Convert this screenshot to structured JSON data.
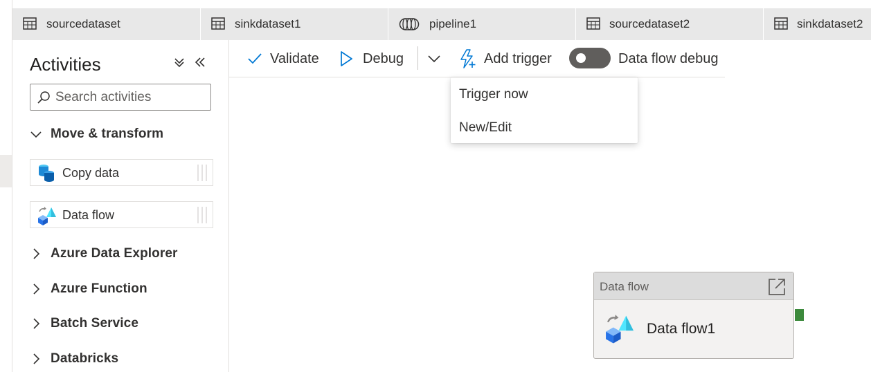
{
  "tabs": [
    {
      "label": "sourcedataset",
      "icon": "table-icon"
    },
    {
      "label": "sinkdataset1",
      "icon": "table-icon"
    },
    {
      "label": "pipeline1",
      "icon": "pipeline-icon"
    },
    {
      "label": "sourcedataset2",
      "icon": "table-icon"
    },
    {
      "label": "sinkdataset2",
      "icon": "table-icon"
    }
  ],
  "sidebar": {
    "title": "Activities",
    "search_placeholder": "Search activities",
    "groups": {
      "move_transform": "Move & transform",
      "azure_data_explorer": "Azure Data Explorer",
      "azure_function": "Azure Function",
      "batch_service": "Batch Service",
      "databricks": "Databricks"
    },
    "activities": {
      "copy_data": "Copy data",
      "data_flow": "Data flow"
    }
  },
  "toolbar": {
    "validate": "Validate",
    "debug": "Debug",
    "add_trigger": "Add trigger",
    "data_flow_debug": "Data flow debug",
    "data_flow_debug_on": false
  },
  "trigger_menu": {
    "trigger_now": "Trigger now",
    "new_edit": "New/Edit"
  },
  "node": {
    "type": "Data flow",
    "name": "Data flow1"
  },
  "colors": {
    "accent": "#0078d4",
    "success_port": "#3c8a3c",
    "toggle_off": "#605e5c"
  }
}
